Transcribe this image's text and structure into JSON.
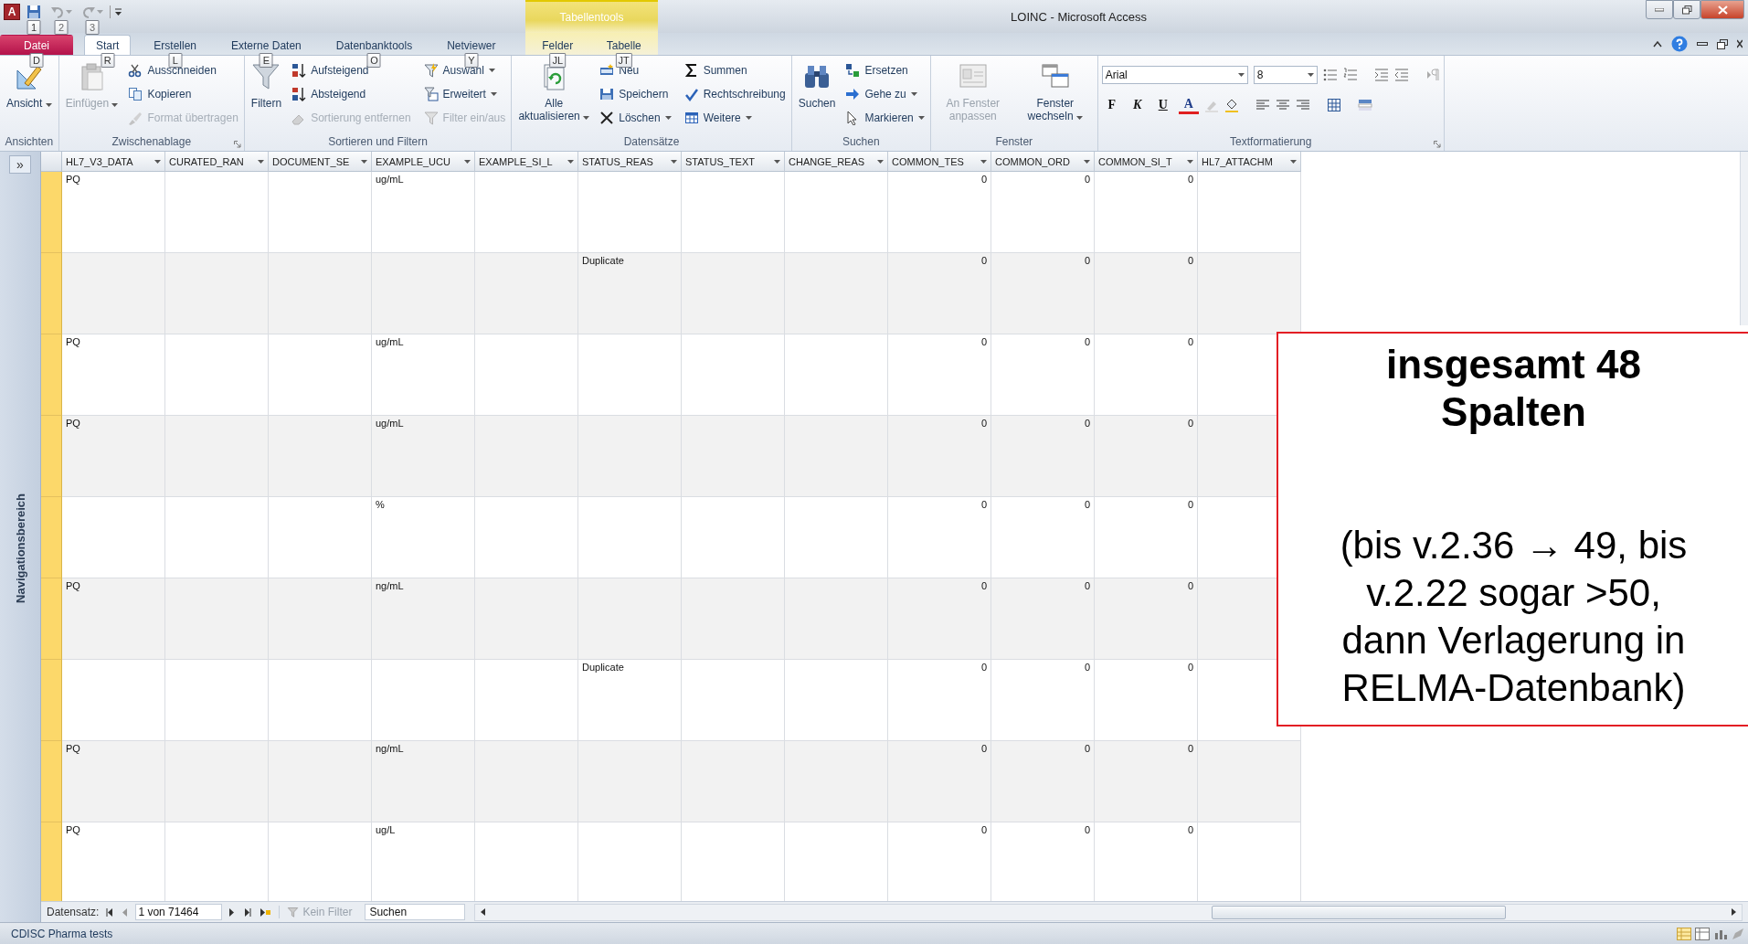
{
  "app": {
    "logo": "A"
  },
  "quick_access": [
    {
      "keytip": "1",
      "disabled": false
    },
    {
      "keytip": "2",
      "disabled": true
    },
    {
      "keytip": "3",
      "disabled": true
    }
  ],
  "window": {
    "title": "LOINC - Microsoft Access",
    "context_group": "Tabellentools"
  },
  "tabs": [
    {
      "label": "Datei",
      "keytip": "D",
      "kind": "file",
      "selected": false
    },
    {
      "label": "Start",
      "keytip": "R",
      "kind": "normal",
      "selected": true
    },
    {
      "label": "Erstellen",
      "keytip": "L",
      "kind": "normal",
      "selected": false
    },
    {
      "label": "Externe Daten",
      "keytip": "E",
      "kind": "normal",
      "selected": false
    },
    {
      "label": "Datenbanktools",
      "keytip": "O",
      "kind": "normal",
      "selected": false
    },
    {
      "label": "Netviewer",
      "keytip": "Y",
      "kind": "normal",
      "selected": false
    },
    {
      "label": "Felder",
      "keytip": "JL",
      "kind": "context",
      "selected": false
    },
    {
      "label": "Tabelle",
      "keytip": "JT",
      "kind": "context",
      "selected": false
    }
  ],
  "ribbon": {
    "groups": [
      {
        "kind": "buttons",
        "label": "Ansichten",
        "items": [
          {
            "kind": "large",
            "label": "Ansicht",
            "disabled": false,
            "dropdown": true
          }
        ]
      },
      {
        "kind": "buttons",
        "label": "Zwischenablage",
        "launcher": true,
        "items": [
          {
            "kind": "large",
            "label": "Einfügen",
            "disabled": true,
            "dropdown": true
          },
          {
            "kind": "small",
            "label": "Ausschneiden",
            "disabled": false,
            "dropdown": false
          },
          {
            "kind": "small",
            "label": "Kopieren",
            "disabled": false,
            "dropdown": false
          },
          {
            "kind": "small",
            "label": "Format übertragen",
            "disabled": true,
            "dropdown": false
          }
        ]
      },
      {
        "kind": "buttons",
        "label": "Sortieren und Filtern",
        "items": [
          {
            "kind": "large",
            "label": "Filtern",
            "disabled": false,
            "dropdown": false
          },
          {
            "kind": "small",
            "label": "Aufsteigend",
            "disabled": false,
            "dropdown": false
          },
          {
            "kind": "small",
            "label": "Absteigend",
            "disabled": false,
            "dropdown": false
          },
          {
            "kind": "small",
            "label": "Sortierung entfernen",
            "disabled": true,
            "dropdown": false
          },
          {
            "kind": "small",
            "label": "Auswahl",
            "disabled": false,
            "dropdown": true
          },
          {
            "kind": "small",
            "label": "Erweitert",
            "disabled": false,
            "dropdown": true
          },
          {
            "kind": "small",
            "label": "Filter ein/aus",
            "disabled": true,
            "dropdown": false
          }
        ]
      },
      {
        "kind": "buttons",
        "label": "Datensätze",
        "items": [
          {
            "kind": "large",
            "label": "Alle aktualisieren",
            "disabled": false,
            "dropdown": true
          },
          {
            "kind": "small",
            "label": "Neu",
            "disabled": false,
            "dropdown": false
          },
          {
            "kind": "small",
            "label": "Speichern",
            "disabled": false,
            "dropdown": false
          },
          {
            "kind": "small",
            "label": "Löschen",
            "disabled": false,
            "dropdown": true
          },
          {
            "kind": "small",
            "label": "Summen",
            "disabled": false,
            "dropdown": false
          },
          {
            "kind": "small",
            "label": "Rechtschreibung",
            "disabled": false,
            "dropdown": false
          },
          {
            "kind": "small",
            "label": "Weitere",
            "disabled": false,
            "dropdown": true
          }
        ]
      },
      {
        "kind": "buttons",
        "label": "Suchen",
        "items": [
          {
            "kind": "large",
            "label": "Suchen",
            "disabled": false,
            "dropdown": false
          },
          {
            "kind": "small",
            "label": "Ersetzen",
            "disabled": false,
            "dropdown": false
          },
          {
            "kind": "small",
            "label": "Gehe zu",
            "disabled": false,
            "dropdown": true
          },
          {
            "kind": "small",
            "label": "Markieren",
            "disabled": false,
            "dropdown": true
          }
        ]
      },
      {
        "kind": "buttons",
        "label": "Fenster",
        "items": [
          {
            "kind": "large",
            "label": "An Fenster anpassen",
            "disabled": true,
            "dropdown": false
          },
          {
            "kind": "large",
            "label": "Fenster wechseln",
            "disabled": false,
            "dropdown": true
          }
        ]
      },
      {
        "kind": "format",
        "label": "Textformatierung",
        "launcher": true,
        "font": "Arial",
        "size": "8",
        "style_buttons": [
          "F",
          "K",
          "U"
        ],
        "color_button": "A"
      }
    ]
  },
  "table": {
    "columns": [
      {
        "label": "HL7_V3_DATA",
        "kind": "text"
      },
      {
        "label": "CURATED_RAN",
        "kind": "text"
      },
      {
        "label": "DOCUMENT_SE",
        "kind": "text"
      },
      {
        "label": "EXAMPLE_UCU",
        "kind": "text"
      },
      {
        "label": "EXAMPLE_SI_L",
        "kind": "text"
      },
      {
        "label": "STATUS_REAS",
        "kind": "text"
      },
      {
        "label": "STATUS_TEXT",
        "kind": "text"
      },
      {
        "label": "CHANGE_REAS",
        "kind": "text"
      },
      {
        "label": "COMMON_TES",
        "kind": "number"
      },
      {
        "label": "COMMON_ORD",
        "kind": "number"
      },
      {
        "label": "COMMON_SI_T",
        "kind": "number"
      },
      {
        "label": "HL7_ATTACHM",
        "kind": "text"
      }
    ],
    "rows": [
      {
        "column_1": "PQ",
        "column_4": "ug/mL",
        "column_9": "0",
        "column_10": "0",
        "column_11": "0"
      },
      {
        "column_6": "Duplicate",
        "column_9": "0",
        "column_10": "0",
        "column_11": "0"
      },
      {
        "column_1": "PQ",
        "column_4": "ug/mL",
        "column_9": "0",
        "column_10": "0",
        "column_11": "0"
      },
      {
        "column_1": "PQ",
        "column_4": "ug/mL",
        "column_9": "0",
        "column_10": "0",
        "column_11": "0"
      },
      {
        "column_4": "%",
        "column_9": "0",
        "column_10": "0",
        "column_11": "0"
      },
      {
        "column_1": "PQ",
        "column_4": "ng/mL",
        "column_9": "0",
        "column_10": "0",
        "column_11": "0"
      },
      {
        "column_6": "Duplicate",
        "column_9": "0",
        "column_10": "0",
        "column_11": "0"
      },
      {
        "column_1": "PQ",
        "column_4": "ng/mL",
        "column_9": "0",
        "column_10": "0",
        "column_11": "0"
      },
      {
        "column_1": "PQ",
        "column_4": "ug/L",
        "column_9": "0",
        "column_10": "0",
        "column_11": "0"
      }
    ]
  },
  "navigation_pane": {
    "toggle": "»",
    "label": "Navigationsbereich"
  },
  "callout": {
    "title": "insgesamt 48 Spalten",
    "text": "(bis v.2.36 → 49, bis v.2.22 sogar >50, dann Verlagerung in RELMA-Datenbank)"
  },
  "record_navigator": {
    "label": "Datensatz:",
    "position": "1 von 71464",
    "filter": {
      "label": "Kein Filter",
      "disabled": true
    },
    "search": {
      "placeholder": "Suchen"
    }
  },
  "status_bar": {
    "text": "CDISC Pharma tests"
  }
}
